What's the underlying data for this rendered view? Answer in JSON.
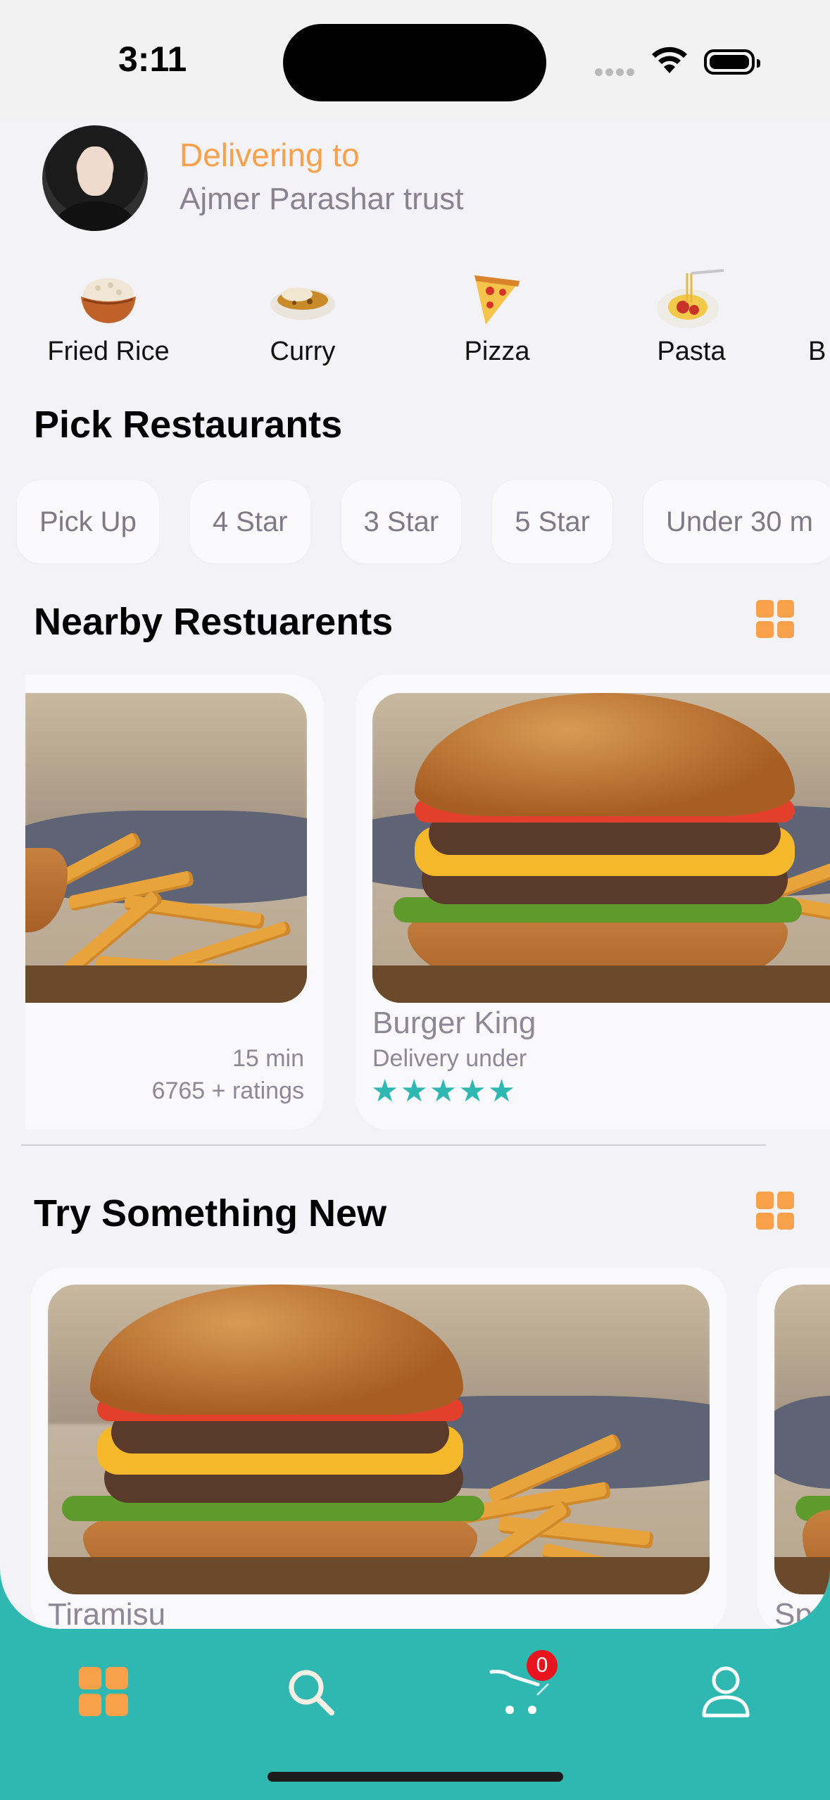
{
  "status_bar": {
    "time": "3:11"
  },
  "header": {
    "delivering_label": "Delivering to",
    "address": "Ajmer Parashar trust"
  },
  "categories": [
    {
      "label": "Fried Rice",
      "icon": "rice-bowl-icon"
    },
    {
      "label": "Curry",
      "icon": "curry-icon"
    },
    {
      "label": "Pizza",
      "icon": "pizza-icon"
    },
    {
      "label": "Pasta",
      "icon": "pasta-icon"
    },
    {
      "label": "B",
      "icon": ""
    }
  ],
  "pick_restaurants": {
    "title": "Pick Restaurants",
    "chips": [
      "Pick Up",
      "4 Star",
      "3 Star",
      "5 Star",
      "Under 30 m"
    ]
  },
  "nearby": {
    "title": "Nearby Restuarents",
    "cards": [
      {
        "time": "15 min",
        "ratings": "6765 + ratings"
      },
      {
        "name": "Burger King",
        "delivery": "Delivery under",
        "stars": "★★★★★",
        "rating": 5
      }
    ]
  },
  "try_new": {
    "title": "Try Something New",
    "cards": [
      {
        "name": "Tiramisu"
      },
      {
        "name": "Sp"
      }
    ]
  },
  "nav": {
    "cart_count": "0"
  },
  "colors": {
    "accent": "#f8a04a",
    "teal": "#2fb8b2",
    "badge": "#e8141e"
  }
}
